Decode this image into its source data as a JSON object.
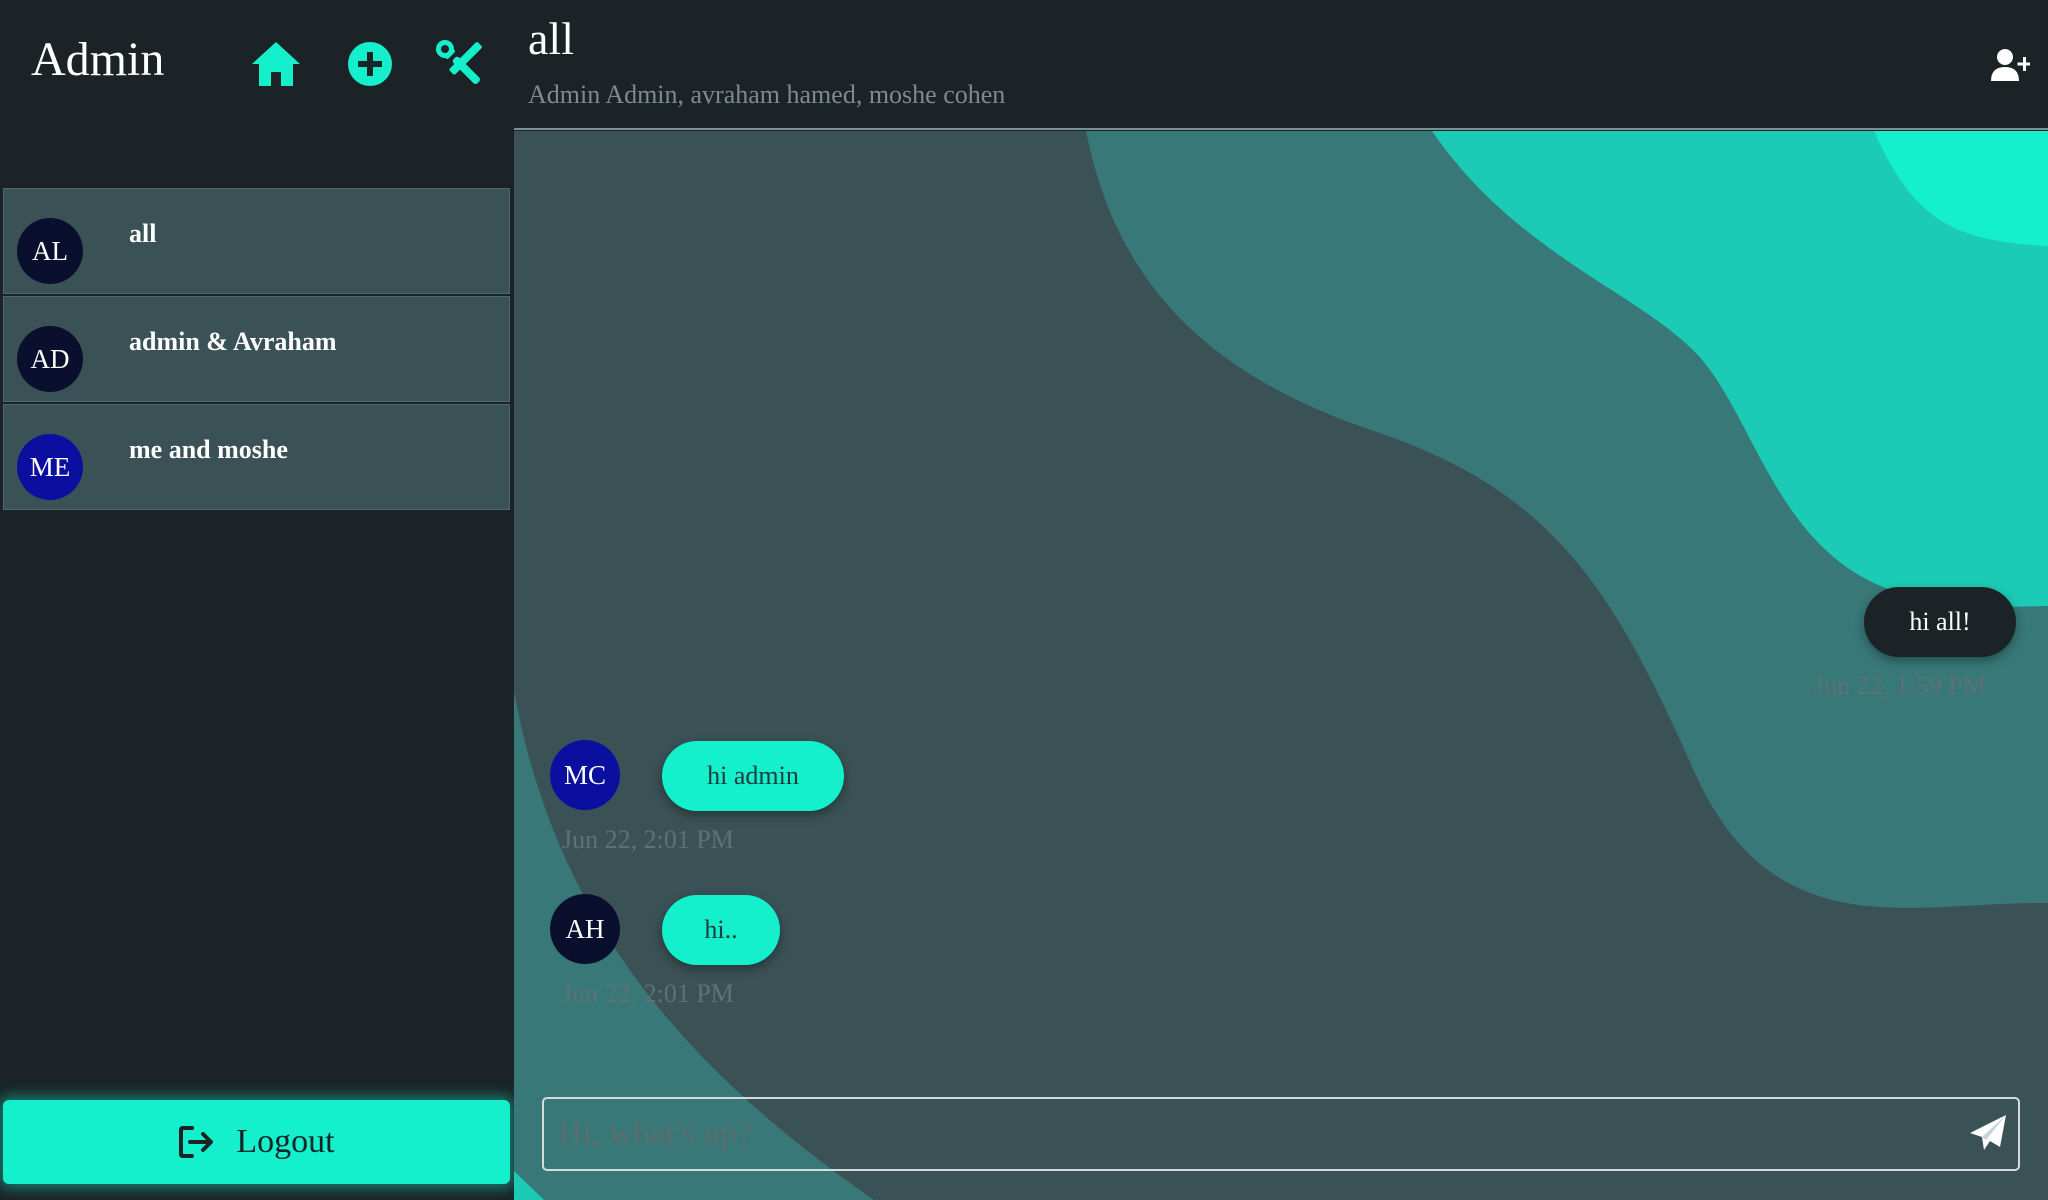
{
  "app": {
    "title": "Admin"
  },
  "colors": {
    "accent": "#14f0cc",
    "background": "#1b2326",
    "panel": "#3a5155"
  },
  "header_icons": [
    "home-icon",
    "add-circle-icon",
    "tools-icon"
  ],
  "chats": [
    {
      "initials": "AL",
      "name": "all",
      "avatar_color": "#0b0f2e"
    },
    {
      "initials": "AD",
      "name": "admin & Avraham",
      "avatar_color": "#0b0f2e"
    },
    {
      "initials": "ME",
      "name": "me and moshe",
      "avatar_color": "#0a0fa0"
    }
  ],
  "logout": {
    "label": "Logout",
    "icon": "logout-icon"
  },
  "chat": {
    "title": "all",
    "members": "Admin Admin, avraham hamed, moshe cohen",
    "add_user_icon": "user-plus-icon",
    "messages": [
      {
        "from_me": true,
        "text": "hi all!",
        "time": "Jun 22, 1:59 PM"
      },
      {
        "from_me": false,
        "initials": "MC",
        "avatar_color": "#0a0fa0",
        "text": "hi admin",
        "time": "Jun 22, 2:01 PM"
      },
      {
        "from_me": false,
        "initials": "AH",
        "avatar_color": "#0b0f2e",
        "text": "hi..",
        "time": "Jun 22, 2:01 PM"
      }
    ],
    "input": {
      "placeholder": "Hi, what's up?",
      "value": ""
    },
    "send_icon": "paper-plane-icon"
  }
}
